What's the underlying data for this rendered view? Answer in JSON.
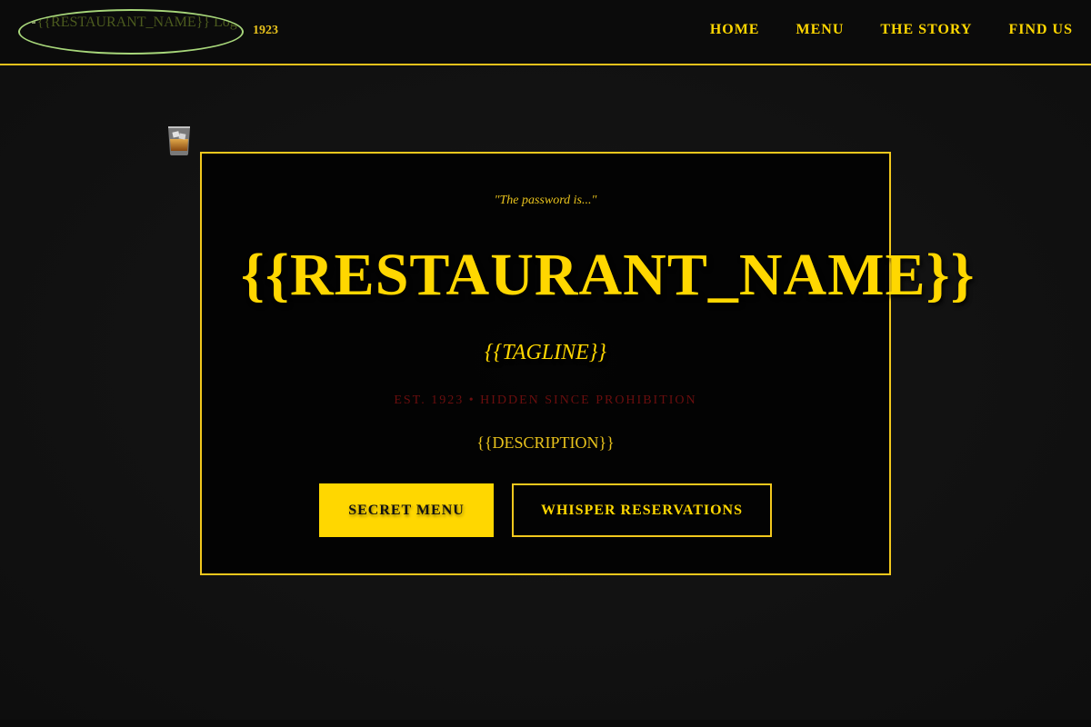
{
  "header": {
    "logo_alt": "{{RESTAURANT_NAME}} Logo",
    "year": "1923",
    "nav": [
      {
        "label": "HOME"
      },
      {
        "label": "MENU"
      },
      {
        "label": "THE STORY"
      },
      {
        "label": "FIND US"
      }
    ]
  },
  "hero": {
    "password": "\"The password is...\"",
    "title": "{{RESTAURANT_NAME}}",
    "tagline": "{{TAGLINE}}",
    "est_line": "EST. 1923 • HIDDEN SINCE PROHIBITION",
    "description": "{{DESCRIPTION}}",
    "primary_button": "SECRET MENU",
    "secondary_button": "WHISPER RESERVATIONS"
  },
  "colors": {
    "accent_gold": "#ffd700",
    "background": "#101010",
    "muted_red": "#6b0e0e",
    "logo_outline": "#a7d67a"
  },
  "icons": {
    "decoration": "whiskey-glass-icon"
  }
}
